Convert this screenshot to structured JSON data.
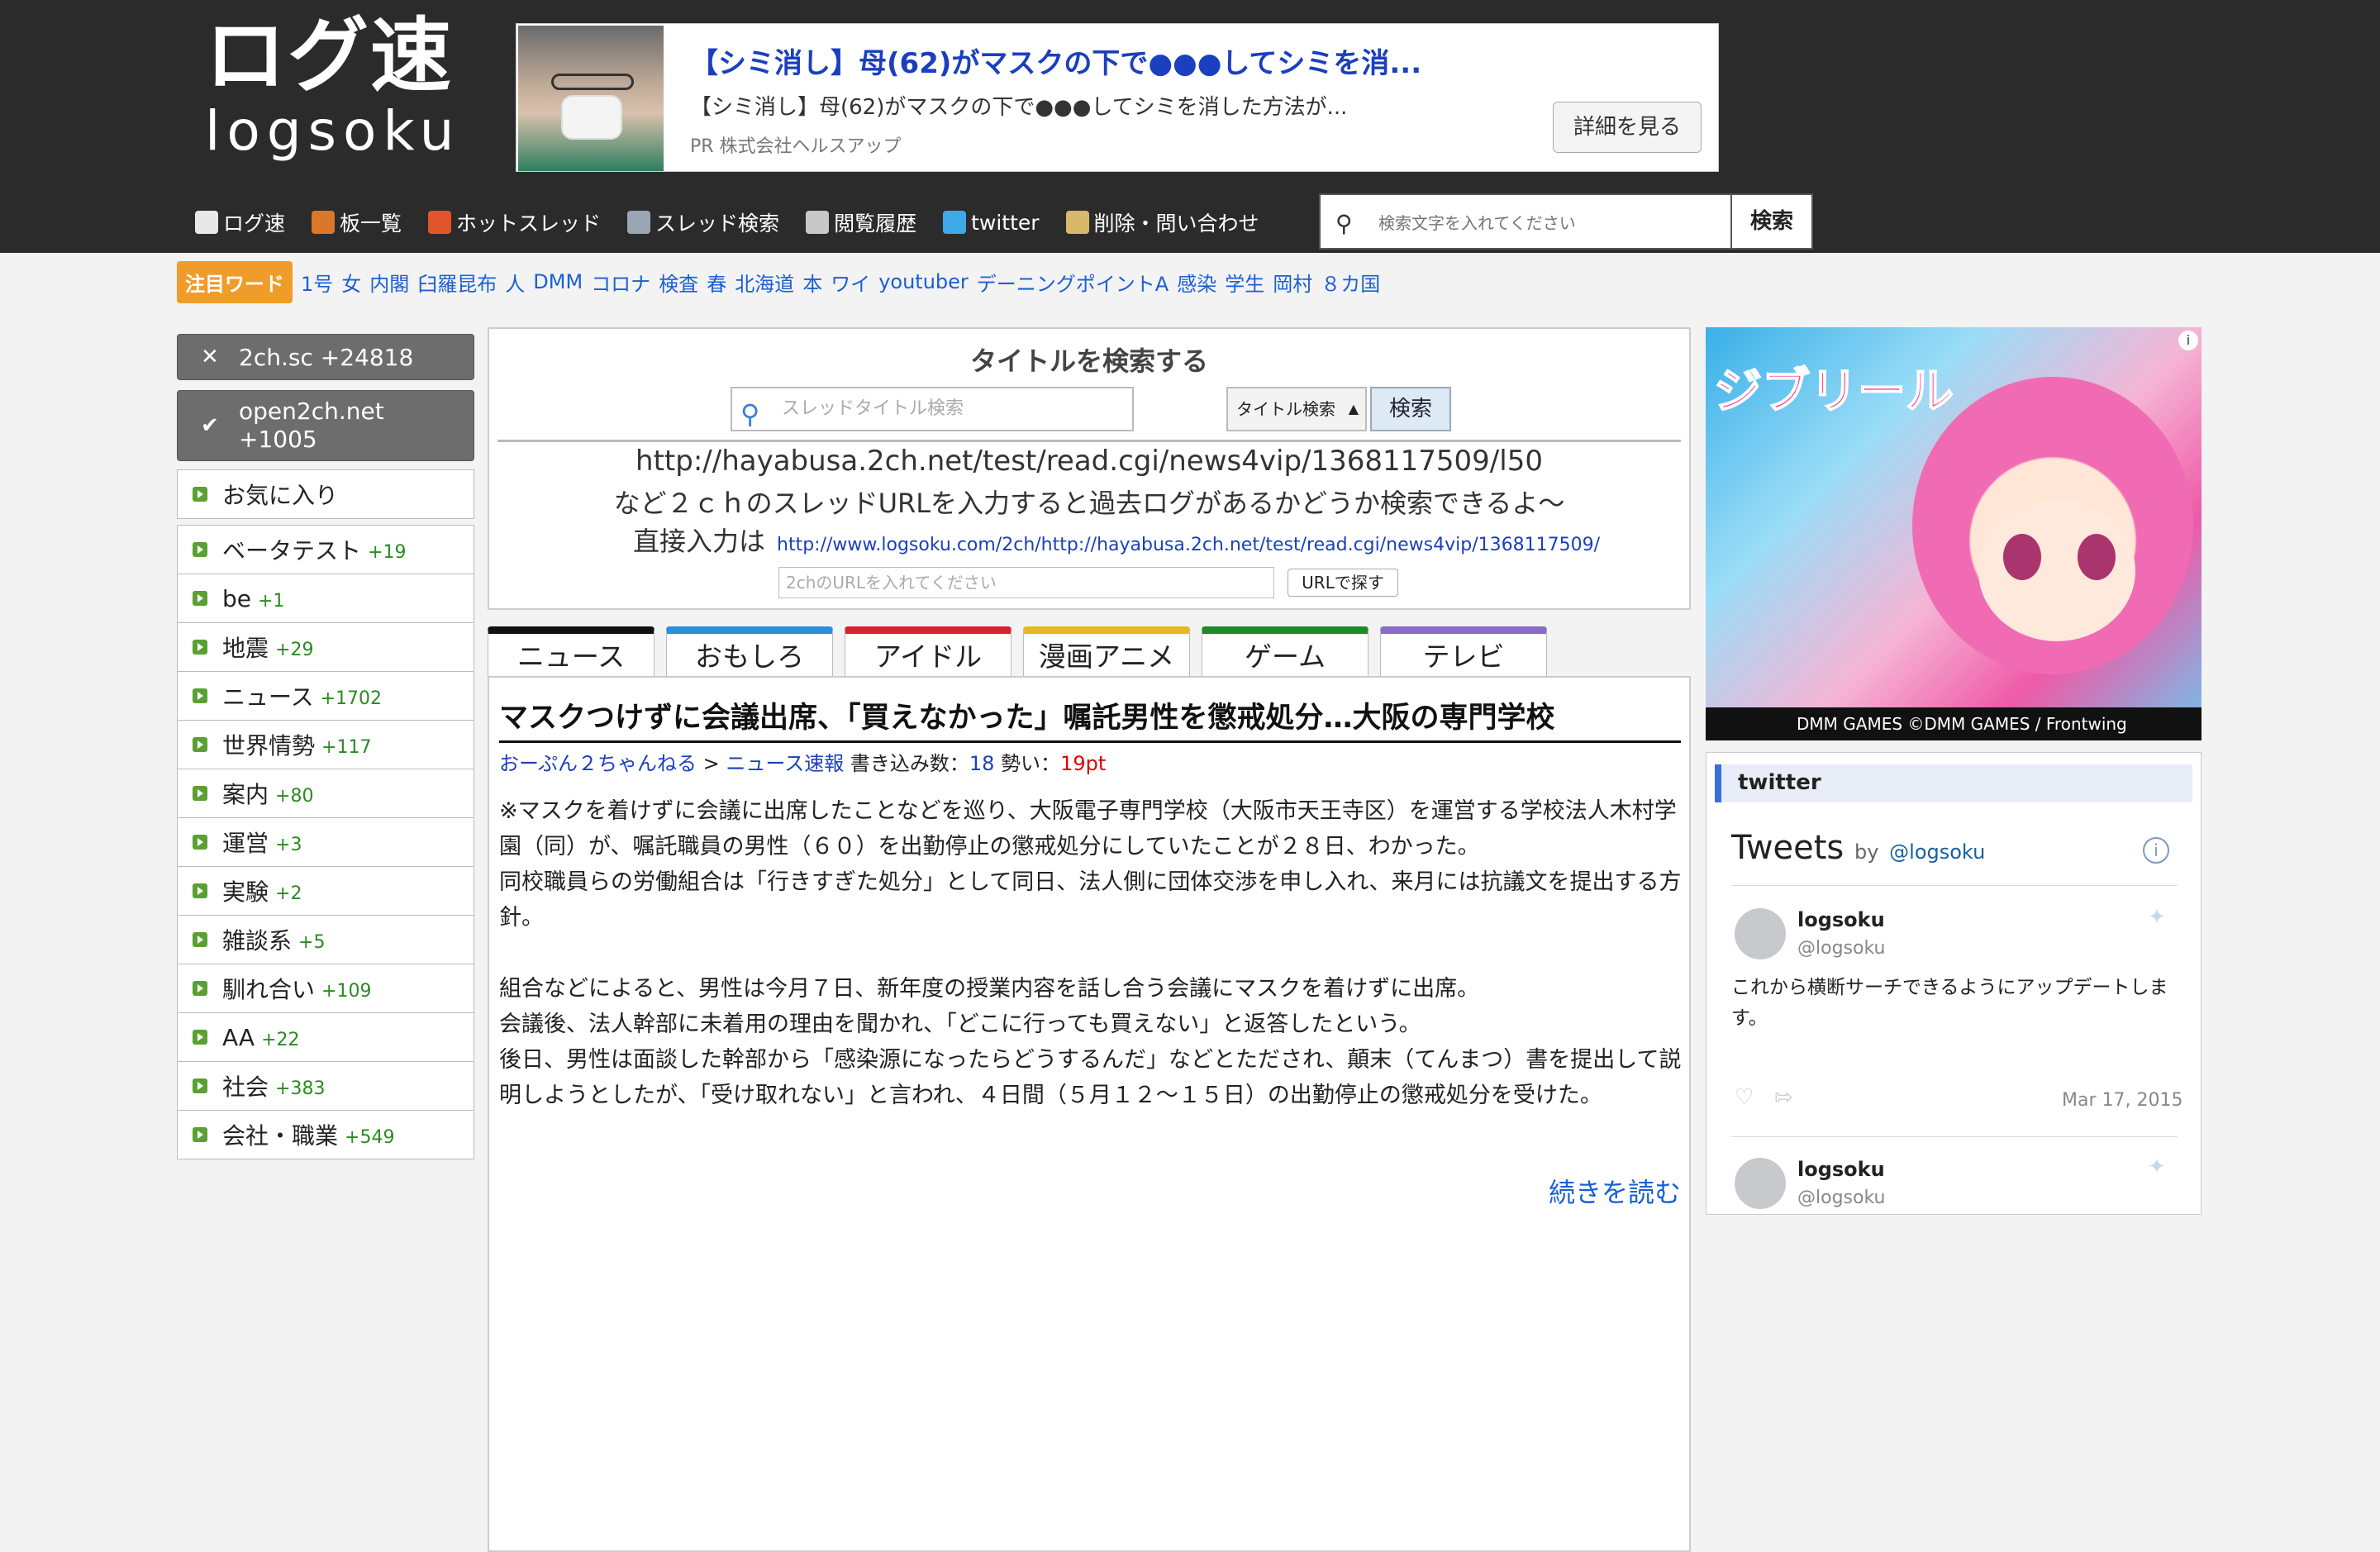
{
  "header": {
    "logo_jp": "ログ速",
    "logo_en": "logsoku",
    "ad": {
      "title": "【シミ消し】母(62)がマスクの下で●●●してシミを消...",
      "desc": "【シミ消し】母(62)がマスクの下で●●●してシミを消した方法が...",
      "pr": "PR 株式会社ヘルスアップ",
      "button": "詳細を見る"
    },
    "nav": [
      {
        "label": "ログ速",
        "icon": "home-icon",
        "color": "#e8e8e8"
      },
      {
        "label": "板一覧",
        "icon": "board-icon",
        "color": "#d9782a"
      },
      {
        "label": "ホットスレッド",
        "icon": "fire-icon",
        "color": "#e2542a"
      },
      {
        "label": "スレッド検索",
        "icon": "thread-search-icon",
        "color": "#9aa6b3"
      },
      {
        "label": "閲覧履歴",
        "icon": "history-icon",
        "color": "#c8c8c8"
      },
      {
        "label": "twitter",
        "icon": "twitter-icon",
        "color": "#3fa9e8"
      },
      {
        "label": "削除・問い合わせ",
        "icon": "mail-icon",
        "color": "#d9b86a"
      }
    ],
    "search_placeholder": "検索文字を入れてください",
    "search_button": "検索"
  },
  "tags": {
    "label": "注目ワード",
    "items": [
      "1号",
      "女",
      "内閣",
      "臼羅昆布",
      "人",
      "DMM",
      "コロナ",
      "検査",
      "春",
      "北海道",
      "本",
      "ワイ",
      "youtuber",
      "デーニングポイントA",
      "感染",
      "学生",
      "岡村",
      "８カ国"
    ]
  },
  "sidebar": {
    "top": [
      {
        "mark": "✕",
        "label": "2ch.sc +24818"
      },
      {
        "mark": "✔",
        "label": "open2ch.net +1005"
      }
    ],
    "favorites": "お気に入り",
    "boards": [
      {
        "name": "ベータテスト",
        "count": "+19"
      },
      {
        "name": "be",
        "count": "+1"
      },
      {
        "name": "地震",
        "count": "+29"
      },
      {
        "name": "ニュース",
        "count": "+1702"
      },
      {
        "name": "世界情勢",
        "count": "+117"
      },
      {
        "name": "案内",
        "count": "+80"
      },
      {
        "name": "運営",
        "count": "+3"
      },
      {
        "name": "実験",
        "count": "+2"
      },
      {
        "name": "雑談系",
        "count": "+5"
      },
      {
        "name": "馴れ合い",
        "count": "+109"
      },
      {
        "name": "AA",
        "count": "+22"
      },
      {
        "name": "社会",
        "count": "+383"
      },
      {
        "name": "会社・職業",
        "count": "+549"
      }
    ]
  },
  "search_panel": {
    "title": "タイトルを検索する",
    "input_placeholder": "スレッドタイトル検索",
    "select_value": "タイトル検索",
    "go": "検索",
    "example_url": "http://hayabusa.2ch.net/test/read.cgi/news4vip/1368117509/l50",
    "explain": "など２ｃｈのスレッドURLを入力すると過去ログがあるかどうか検索できるよ〜",
    "direct_label": "直接入力は",
    "direct_url": "http://www.logsoku.com/2ch/http://hayabusa.2ch.net/test/read.cgi/news4vip/1368117509/",
    "url_placeholder": "2chのURLを入れてください",
    "url_button": "URLで探す"
  },
  "tabs": [
    {
      "label": "ニュース",
      "color": "#111111"
    },
    {
      "label": "おもしろ",
      "color": "#2a8fd8"
    },
    {
      "label": "アイドル",
      "color": "#d8232a"
    },
    {
      "label": "漫画アニメ",
      "color": "#e8b820"
    },
    {
      "label": "ゲーム",
      "color": "#1e8a2a"
    },
    {
      "label": "テレビ",
      "color": "#8b6cc8"
    }
  ],
  "article": {
    "title": "マスクつけずに会議出席、「買えなかった」嘱託男性を懲戒処分…大阪の専門学校",
    "source": "おーぷん２ちゃんねる",
    "sep": " > ",
    "board": "ニュース速報",
    "posts_label": "書き込み数：",
    "posts": "18",
    "momentum_label": "勢い：",
    "momentum": "19pt",
    "body": [
      "※マスクを着けずに会議に出席したことなどを巡り、大阪電子専門学校（大阪市天王寺区）を運営する学校法人木村学園（同）が、嘱託職員の男性（６０）を出勤停止の懲戒処分にしていたことが２８日、わかった。",
      "同校職員らの労働組合は「行きすぎた処分」として同日、法人側に団体交渉を申し入れ、来月には抗議文を提出する方針。",
      "",
      "組合などによると、男性は今月７日、新年度の授業内容を話し合う会議にマスクを着けずに出席。",
      "会議後、法人幹部に未着用の理由を聞かれ、「どこに行っても買えない」と返答したという。",
      "後日、男性は面談した幹部から「感染源になったらどうするんだ」などとただされ、顛末（てんまつ）書を提出して説明しようとしたが、「受け取れない」と言われ、４日間（５月１２〜１５日）の出勤停止の懲戒処分を受けた。"
    ],
    "read_more": "続きを読む"
  },
  "right_ad": {
    "logo": "ジブリール",
    "footer": "DMM GAMES  ©DMM GAMES / Frontwing",
    "info": "i"
  },
  "twitter": {
    "header": "twitter",
    "tweets_label": "Tweets",
    "by": "by",
    "handle": "@logsoku",
    "tweets": [
      {
        "name": "logsoku",
        "handle": "@logsoku",
        "text": "これから横断サーチできるようにアップデートします。",
        "date": "Mar 17, 2015"
      },
      {
        "name": "logsoku",
        "handle": "@logsoku"
      }
    ]
  }
}
